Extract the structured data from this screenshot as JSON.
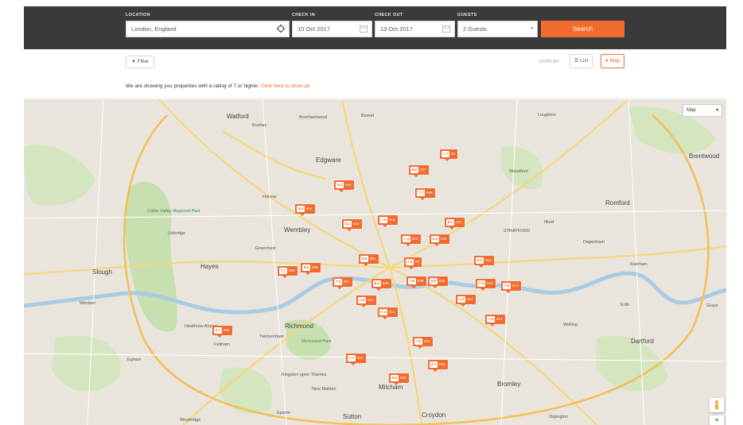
{
  "search": {
    "location_label": "LOCATION",
    "location_value": "London, England",
    "checkin_label": "CHECK IN",
    "checkin_value": "10 Oct 2017",
    "checkout_label": "CHECK OUT",
    "checkout_value": "13 Oct 2017",
    "guests_label": "GUESTS",
    "guests_value": "2 Guests",
    "search_button": "Search"
  },
  "toolbar": {
    "filter_label": "Filter",
    "display_label": "DISPLAY:",
    "list_label": "List",
    "map_label": "Map"
  },
  "notice": {
    "text": "We are showing you properties with a rating of 7 or higher.",
    "link": "Click here to show all"
  },
  "map": {
    "map_type": "Map",
    "zoom_in": "+",
    "labels": {
      "watford": "Watford",
      "bushey": "Bushey",
      "borehamwood": "Borehamwood",
      "barnet": "Barnet",
      "edgware": "Edgware",
      "harrow": "Harrow",
      "wembley": "Wembley",
      "slough": "Slough",
      "hayes": "Hayes",
      "romford": "Romford",
      "dagenham": "Dagenham",
      "brentwood": "Brentwood",
      "dartford": "Dartford",
      "bromley": "Bromley",
      "croydon": "Croydon",
      "sutton": "Sutton",
      "mitcham": "Mitcham",
      "richmond": "Richmond",
      "twickenham": "Twickenham",
      "windsor": "Windsor",
      "uxbridge": "Uxbridge",
      "greenford": "Greenford",
      "ilford": "Ilford",
      "stratford": "STRATFORD",
      "kingston": "Kingston upon Thames",
      "feltham": "Feltham",
      "heathrow": "Heathrow Airport",
      "grays": "Grays",
      "welling": "Welling",
      "new_malden": "New Malden",
      "colne_valley": "Colne Valley Regional Park",
      "richmond_park": "Richmond Park",
      "loughton": "Loughton",
      "woodford": "Woodford",
      "rainham": "Rainham",
      "erith": "Erith",
      "orpington": "Orpington",
      "epsom": "Epsom",
      "egham": "Egham",
      "weybridge": "Weybridge"
    },
    "pins": [
      {
        "score": "7.7",
        "price": "€6"
      },
      {
        "score": "8.6",
        "price": "€27"
      },
      {
        "score": "8.3",
        "price": "€18"
      },
      {
        "score": "7.7",
        "price": "€89"
      },
      {
        "score": "8.4",
        "price": "€94"
      },
      {
        "score": "7.5",
        "price": "€16"
      },
      {
        "score": "8.1",
        "price": "€18"
      },
      {
        "score": "8.1",
        "price": "€71"
      },
      {
        "score": "7.4",
        "price": "€19"
      },
      {
        "score": "8.4",
        "price": "€25"
      },
      {
        "score": "7.7",
        "price": "€65"
      },
      {
        "score": "8.6",
        "price": "€85"
      },
      {
        "score": "8.8",
        "price": "€61"
      },
      {
        "score": "7.6",
        "price": "€8"
      },
      {
        "score": "8.1",
        "price": "€16"
      },
      {
        "score": "7.9",
        "price": "€17"
      },
      {
        "score": "8.4",
        "price": "€25"
      },
      {
        "score": "7.8",
        "price": "€79"
      },
      {
        "score": "8.0",
        "price": "€25"
      },
      {
        "score": "7.5",
        "price": "€18"
      },
      {
        "score": "7.6",
        "price": "€17"
      },
      {
        "score": "7.8",
        "price": "€14"
      },
      {
        "score": "7.6",
        "price": "€14"
      },
      {
        "score": "7.3",
        "price": "€13"
      },
      {
        "score": "7.9",
        "price": "€13"
      },
      {
        "score": "9.7",
        "price": "€92"
      },
      {
        "score": "7.5",
        "price": "€13"
      },
      {
        "score": "7.7",
        "price": "€25"
      },
      {
        "score": "8.1",
        "price": "€50"
      },
      {
        "score": "8.5",
        "price": "€98"
      }
    ]
  },
  "colors": {
    "accent": "#f26b2f",
    "header_bg": "#3a3a3a",
    "map_land": "#e9e5dc",
    "map_green": "#c8dfb0",
    "map_water": "#a9cbe6",
    "road_yellow": "#f6d77b"
  },
  "icons": [
    "filter-icon",
    "list-icon",
    "map-pin-icon",
    "crosshair-icon",
    "calendar-icon",
    "chevron-down-icon",
    "pegman-icon"
  ]
}
